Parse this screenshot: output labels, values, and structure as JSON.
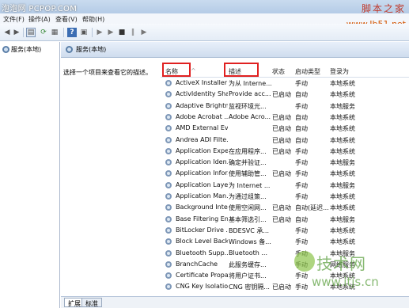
{
  "watermarks": {
    "top_left": "泡泡网 PCPOP.COM",
    "top_right": "脚本之家",
    "top_right_url": "www.Jb51.net",
    "logo_title": "技术网",
    "logo_url": "www.itjs.cn"
  },
  "menu": [
    "文件(F)",
    "操作(A)",
    "查看(V)",
    "帮助(H)"
  ],
  "tree": {
    "root_label": "服务(本地)"
  },
  "panel": {
    "title": "服务(本地)",
    "description_prompt": "选择一个项目来查看它的描述。"
  },
  "table": {
    "headers": {
      "name": "名称",
      "desc": "描述",
      "status": "状态",
      "startup": "启动类型",
      "logon": "登录为"
    },
    "rows": [
      {
        "name": "ActiveX Installer ...",
        "desc": "为从 Interne...",
        "status": "",
        "startup": "手动",
        "logon": "本地系统"
      },
      {
        "name": "ActivIdentity Sha...",
        "desc": "Provide acc...",
        "status": "已启动",
        "startup": "自动",
        "logon": "本地系统"
      },
      {
        "name": "Adaptive Brightn...",
        "desc": "监视环境光...",
        "status": "",
        "startup": "手动",
        "logon": "本地服务"
      },
      {
        "name": "Adobe Acrobat ...",
        "desc": "Adobe Acro...",
        "status": "已启动",
        "startup": "自动",
        "logon": "本地系统"
      },
      {
        "name": "AMD External Ev...",
        "desc": "",
        "status": "已启动",
        "startup": "自动",
        "logon": "本地系统"
      },
      {
        "name": "Andrea ADI Filte...",
        "desc": "",
        "status": "已启动",
        "startup": "自动",
        "logon": "本地系统"
      },
      {
        "name": "Application Expe...",
        "desc": "在应用程序...",
        "status": "已启动",
        "startup": "手动",
        "logon": "本地系统"
      },
      {
        "name": "Application Iden...",
        "desc": "确定并验证...",
        "status": "",
        "startup": "手动",
        "logon": "本地服务"
      },
      {
        "name": "Application Infor...",
        "desc": "使用辅助管...",
        "status": "已启动",
        "startup": "手动",
        "logon": "本地系统"
      },
      {
        "name": "Application Laye...",
        "desc": "为 Internet ...",
        "status": "",
        "startup": "手动",
        "logon": "本地服务"
      },
      {
        "name": "Application Man...",
        "desc": "为通过组策...",
        "status": "",
        "startup": "手动",
        "logon": "本地系统"
      },
      {
        "name": "Background Inte...",
        "desc": "使用空闲网...",
        "status": "已启动",
        "startup": "自动(延迟...",
        "logon": "本地系统"
      },
      {
        "name": "Base Filtering En...",
        "desc": "基本筛选引...",
        "status": "已启动",
        "startup": "自动",
        "logon": "本地服务"
      },
      {
        "name": "BitLocker Drive ...",
        "desc": "BDESVC 承...",
        "status": "",
        "startup": "手动",
        "logon": "本地系统"
      },
      {
        "name": "Block Level Back...",
        "desc": "Windows 备...",
        "status": "",
        "startup": "手动",
        "logon": "本地系统"
      },
      {
        "name": "Bluetooth Supp...",
        "desc": "Bluetooth ...",
        "status": "",
        "startup": "手动",
        "logon": "本地服务"
      },
      {
        "name": "BranchCache",
        "desc": "此服务缓存...",
        "status": "",
        "startup": "手动",
        "logon": "网络服务"
      },
      {
        "name": "Certificate Propa...",
        "desc": "将用户证书...",
        "status": "",
        "startup": "手动",
        "logon": "本地系统"
      },
      {
        "name": "CNG Key Isolation",
        "desc": "CNG 密钥隔...",
        "status": "已启动",
        "startup": "手动",
        "logon": "本地系统"
      }
    ]
  },
  "tabs": [
    "扩展",
    "标准"
  ]
}
